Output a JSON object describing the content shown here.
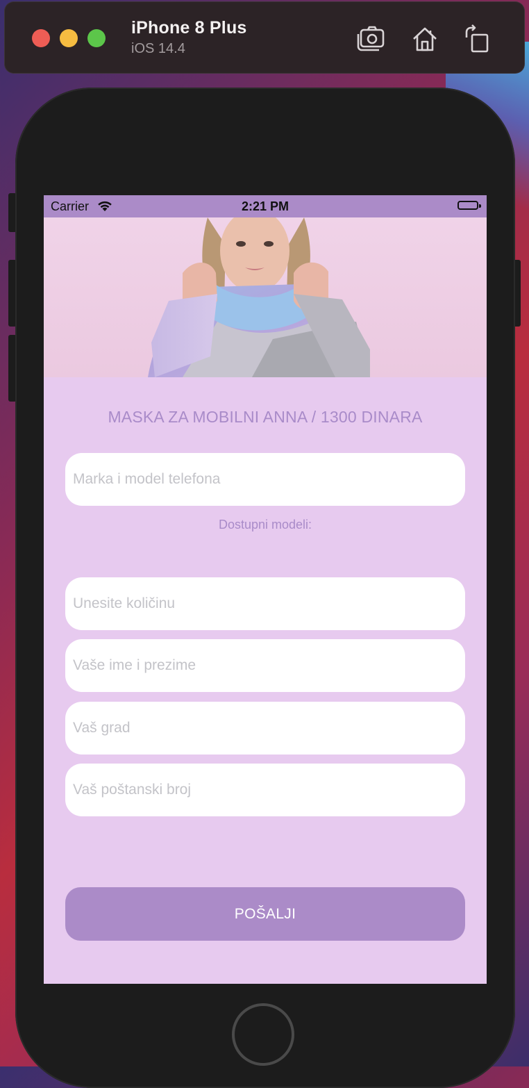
{
  "simulator": {
    "device_name": "iPhone 8 Plus",
    "os_version": "iOS 14.4",
    "toolbar_icons": [
      "screenshot-icon",
      "home-icon",
      "rotate-icon"
    ]
  },
  "status_bar": {
    "carrier": "Carrier",
    "time": "2:21 PM",
    "background_color": "#ab8bc8"
  },
  "form": {
    "product_title": "MASKA ZA MOBILNI ANNA / 1300 DINARA",
    "phone_model_placeholder": "Marka i model telefona",
    "available_models_label": "Dostupni modeli:",
    "quantity_placeholder": "Unesite količinu",
    "name_placeholder": "Vaše ime i prezime",
    "city_placeholder": "Vaš grad",
    "postal_placeholder": "Vaš poštanski broj",
    "submit_label": "POŠALJI",
    "background_color": "#e7caef",
    "accent_color": "#ab8bc8"
  }
}
